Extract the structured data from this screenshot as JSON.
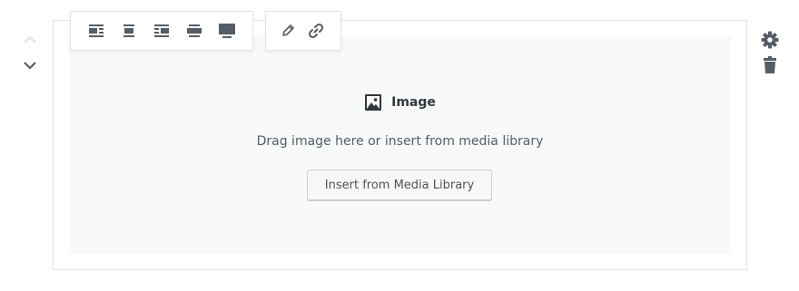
{
  "block": {
    "title": "Image",
    "instructions": "Drag image here or insert from media library",
    "insert_button_label": "Insert from Media Library"
  },
  "icons": {
    "move_up": "chevron-up-icon",
    "move_down": "chevron-down-icon",
    "align_left": "align-left-icon",
    "align_center": "align-center-icon",
    "align_right": "align-right-icon",
    "align_wide": "align-wide-icon",
    "align_full": "align-full-icon",
    "edit": "pencil-icon",
    "link": "link-icon",
    "settings": "gear-icon",
    "delete": "trash-icon",
    "block_type": "image-icon"
  },
  "colors": {
    "icon": "#555d66",
    "border": "#e2e4e7",
    "placeholder_bg": "#f8f9f9",
    "disabled": "#ccd0d4"
  }
}
